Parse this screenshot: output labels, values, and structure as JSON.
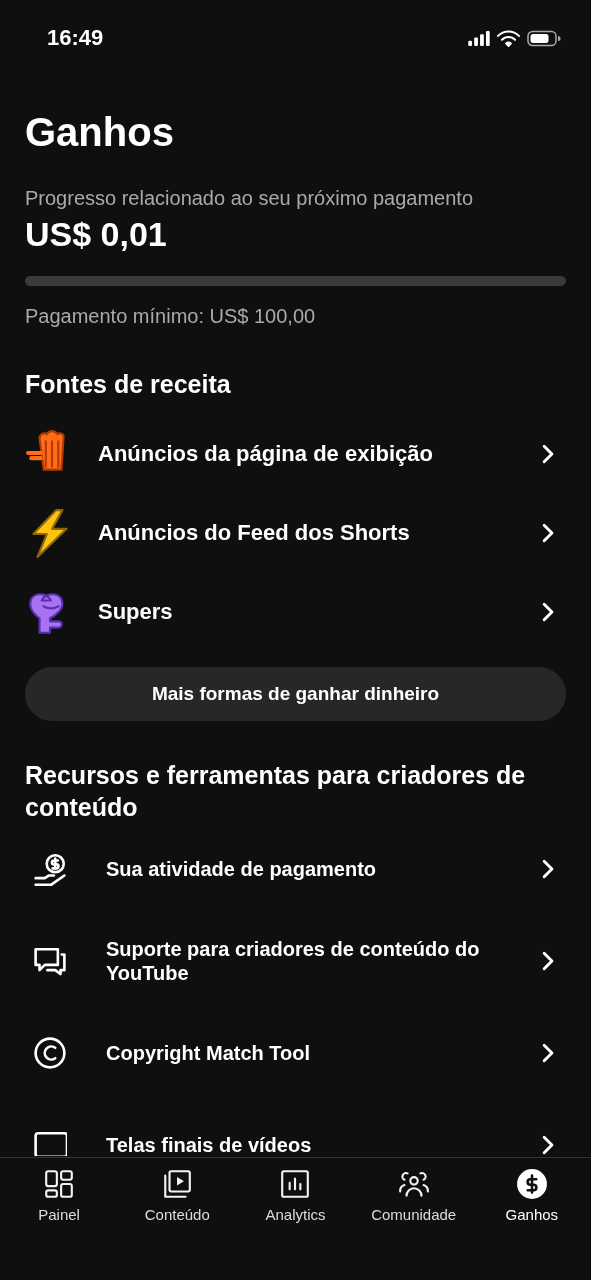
{
  "status_bar": {
    "time": "16:49"
  },
  "title": "Ganhos",
  "progress": {
    "label": "Progresso relacionado ao seu próximo pagamento",
    "amount": "US$ 0,01",
    "level": 0.0001,
    "minimum": "Pagamento mínimo: US$ 100,00"
  },
  "revenue_sources": {
    "heading": "Fontes de receita",
    "items": [
      {
        "kind": "popcorn",
        "label": "Anúncios da página de exibição"
      },
      {
        "kind": "bolt",
        "label": "Anúncios do Feed dos Shorts"
      },
      {
        "kind": "heart",
        "label": "Supers"
      }
    ]
  },
  "more_button": "Mais formas de ganhar dinheiro",
  "resources": {
    "heading": "Recursos e ferramentas para criadores de conteúdo",
    "items": [
      {
        "kind": "payment",
        "label": "Sua atividade de pagamento"
      },
      {
        "kind": "chat",
        "label": "Suporte para criadores de conteúdo do YouTube"
      },
      {
        "kind": "copyright",
        "label": "Copyright Match Tool"
      },
      {
        "kind": "screen",
        "label": "Telas finais de vídeos"
      }
    ]
  },
  "tab_bar": [
    {
      "kind": "dashboard",
      "label": "Painel",
      "selected": false
    },
    {
      "kind": "content",
      "label": "Conteúdo",
      "selected": false
    },
    {
      "kind": "analytics",
      "label": "Analytics",
      "selected": false
    },
    {
      "kind": "community",
      "label": "Comunidade",
      "selected": false
    },
    {
      "kind": "earn",
      "label": "Ganhos",
      "selected": true
    }
  ]
}
